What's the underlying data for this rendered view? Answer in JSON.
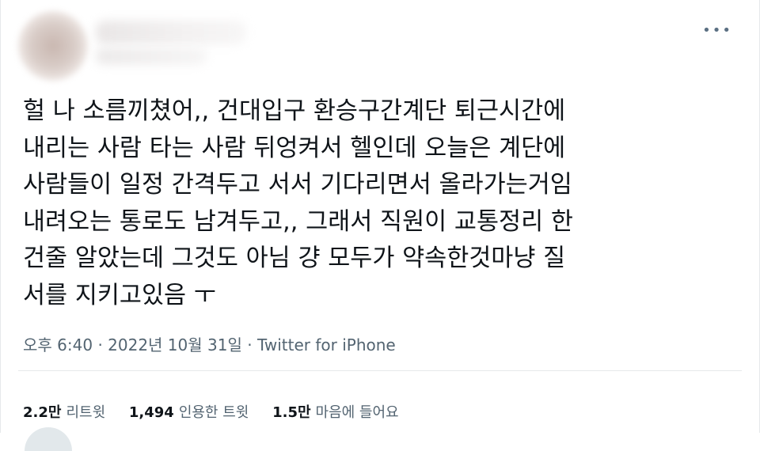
{
  "tweet": {
    "more_icon": "more-horizontal-icon",
    "text_lines": [
      "헐 나 소름끼쳤어,, 건대입구 환승구간계단 퇴근시간에",
      "내리는 사람 타는 사람 뒤엉켜서 헬인데 오늘은 계단에",
      "사람들이 일정 간격두고 서서 기다리면서 올라가는거임",
      "내려오는 통로도 남겨두고,, 그래서 직원이 교통정리 한",
      "건줄 알았는데 그것도 아님 걍 모두가 약속한것마냥 질",
      "서를 지키고있음 ㅜ"
    ],
    "time": "오후 6:40",
    "date": "2022년 10월 31일",
    "separator": "·",
    "source": "Twitter for iPhone"
  },
  "stats": {
    "retweets_count": "2.2만",
    "retweets_label": "리트윗",
    "quotes_count": "1,494",
    "quotes_label": "인용한 트윗",
    "likes_count": "1.5만",
    "likes_label": "마음에 들어요"
  }
}
